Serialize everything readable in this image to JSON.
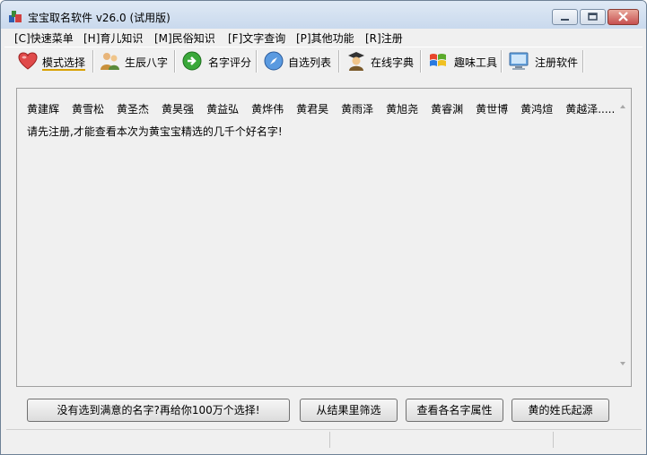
{
  "window": {
    "title": "宝宝取名软件 v26.0 (试用版)"
  },
  "menu": {
    "items": [
      {
        "label": "[C]快速菜单"
      },
      {
        "label": "[H]育儿知识"
      },
      {
        "label": "[M]民俗知识"
      },
      {
        "label": "[F]文字查询"
      },
      {
        "label": "[P]其他功能"
      },
      {
        "label": "[R]注册"
      }
    ]
  },
  "toolbar": {
    "items": [
      {
        "label": "模式选择",
        "icon": "heart-icon",
        "active": true
      },
      {
        "label": "生辰八字",
        "icon": "people-icon"
      },
      {
        "label": "名字评分",
        "icon": "green-arrow-icon"
      },
      {
        "label": "自选列表",
        "icon": "compass-icon"
      },
      {
        "label": "在线字典",
        "icon": "scholar-icon"
      },
      {
        "label": "趣味工具",
        "icon": "windows-flag-icon"
      },
      {
        "label": "注册软件",
        "icon": "monitor-icon"
      }
    ]
  },
  "results": {
    "names": [
      "黄建辉",
      "黄雪松",
      "黄圣杰",
      "黄昊强",
      "黄益弘",
      "黄烨伟",
      "黄君昊",
      "黄雨泽",
      "黄旭尧",
      "黄睿渊",
      "黄世博",
      "黄鸿煊",
      "黄越泽....."
    ],
    "notice": "请先注册,才能查看本次为黄宝宝精选的几千个好名字!"
  },
  "buttons": {
    "more_choices": "没有选到满意的名字?再给你100万个选择!",
    "filter": "从结果里筛选",
    "attributes": "查看各名字属性",
    "surname_origin": "黄的姓氏起源"
  }
}
